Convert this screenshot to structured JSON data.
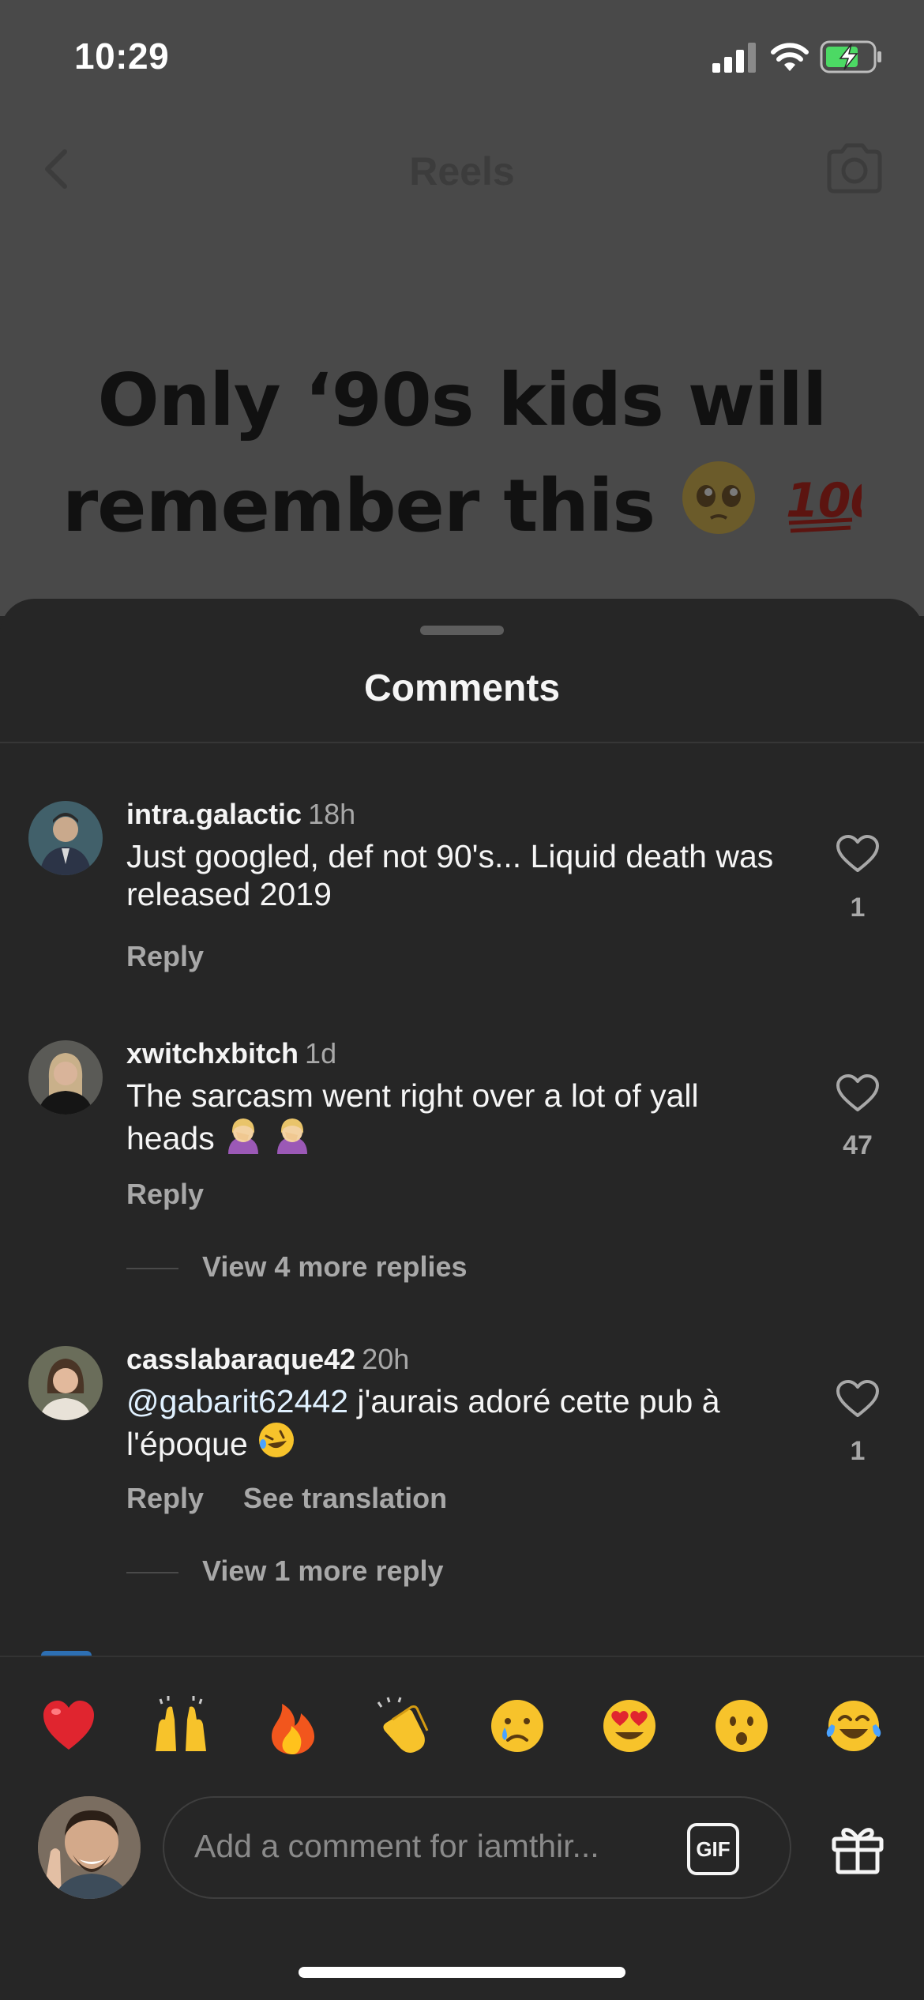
{
  "status_bar": {
    "time": "10:29"
  },
  "header": {
    "title": "Reels"
  },
  "video": {
    "caption_line1": "Only ‘90s kids will",
    "caption_line2": "remember this"
  },
  "sheet": {
    "title": "Comments"
  },
  "comments": [
    {
      "username": "intra.galactic",
      "time": "18h",
      "text": "Just googled, def not 90's... Liquid death was released 2019",
      "reply_label": "Reply",
      "likes": "1"
    },
    {
      "username": "xwitchxbitch",
      "time": "1d",
      "text": "The sarcasm went right over a lot of yall heads",
      "reply_label": "Reply",
      "likes": "47",
      "view_replies": "View 4 more replies"
    },
    {
      "username": "casslabaraque42",
      "time": "20h",
      "mention": "@gabarit62442",
      "text": " j'aurais adoré cette pub à l'époque",
      "reply_label": "Reply",
      "translate_label": "See translation",
      "likes": "1",
      "view_replies": "View 1 more reply"
    }
  ],
  "quick_emojis": [
    "red-heart",
    "raising-hands",
    "fire",
    "clapping-hands",
    "crying-face",
    "heart-eyes",
    "surprised-face",
    "tears-of-joy"
  ],
  "composer": {
    "placeholder": "Add a comment for iamthir...",
    "gif_label": "GIF"
  },
  "colors": {
    "sheet_bg": "#262626",
    "secondary_text": "#a8a8a8",
    "battery_green": "#4cd964",
    "mention": "#e0f1ff"
  }
}
